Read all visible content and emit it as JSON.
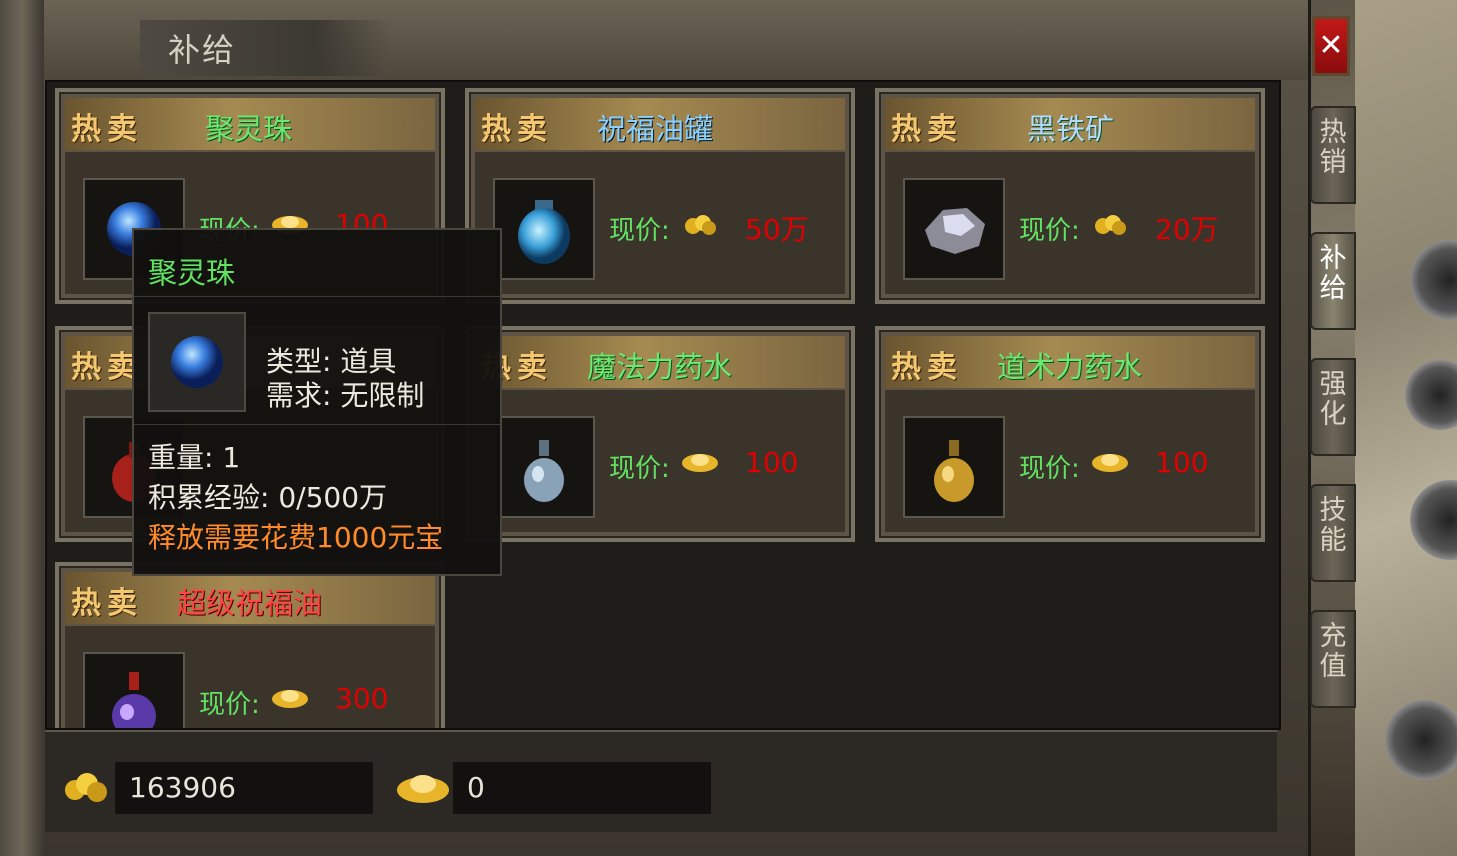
{
  "window": {
    "title": "补给",
    "close_label": "✕"
  },
  "hot_label": "热卖",
  "cards": [
    {
      "name": "聚灵珠",
      "price_label": "现价:",
      "price": "100",
      "currency": "yuanbao-icon",
      "name_color": "green"
    },
    {
      "name": "祝福油罐",
      "price_label": "现价:",
      "price": "50万",
      "currency": "gold-icon",
      "name_color": "blue"
    },
    {
      "name": "黑铁矿",
      "price_label": "现价:",
      "price": "20万",
      "currency": "gold-icon",
      "name_color": "white"
    },
    {
      "name": "",
      "price_label": "",
      "price": "",
      "currency": "yuanbao-icon",
      "name_color": "green"
    },
    {
      "name": "魔法力药水",
      "price_label": "现价:",
      "price": "100",
      "currency": "yuanbao-icon",
      "name_color": "green"
    },
    {
      "name": "道术力药水",
      "price_label": "现价:",
      "price": "100",
      "currency": "yuanbao-icon",
      "name_color": "green"
    },
    {
      "name": "超级祝福油",
      "price_label": "现价:",
      "price": "300",
      "currency": "yuanbao-icon",
      "name_color": "red"
    }
  ],
  "tooltip": {
    "title": "聚灵珠",
    "type_line": "类型:  道具",
    "req_line": "需求:  无限制",
    "weight_line": "重量:  1",
    "exp_line": "积累经验:  0/500万",
    "cost_line": "释放需要花费1000元宝"
  },
  "balance": {
    "gold": "163906",
    "yuanbao": "0"
  },
  "side_tabs": [
    {
      "label": [
        "热",
        "销"
      ],
      "active": false
    },
    {
      "label": [
        "补",
        "给"
      ],
      "active": true
    },
    {
      "label": [
        "强",
        "化"
      ],
      "active": false
    },
    {
      "label": [
        "技",
        "能"
      ],
      "active": false
    },
    {
      "label": [
        "充",
        "值"
      ],
      "active": false
    }
  ],
  "colors": {
    "price_label": "#62e262",
    "price_value": "#e00000",
    "hot_label": "#f4c870",
    "close_button": "#c21818"
  }
}
